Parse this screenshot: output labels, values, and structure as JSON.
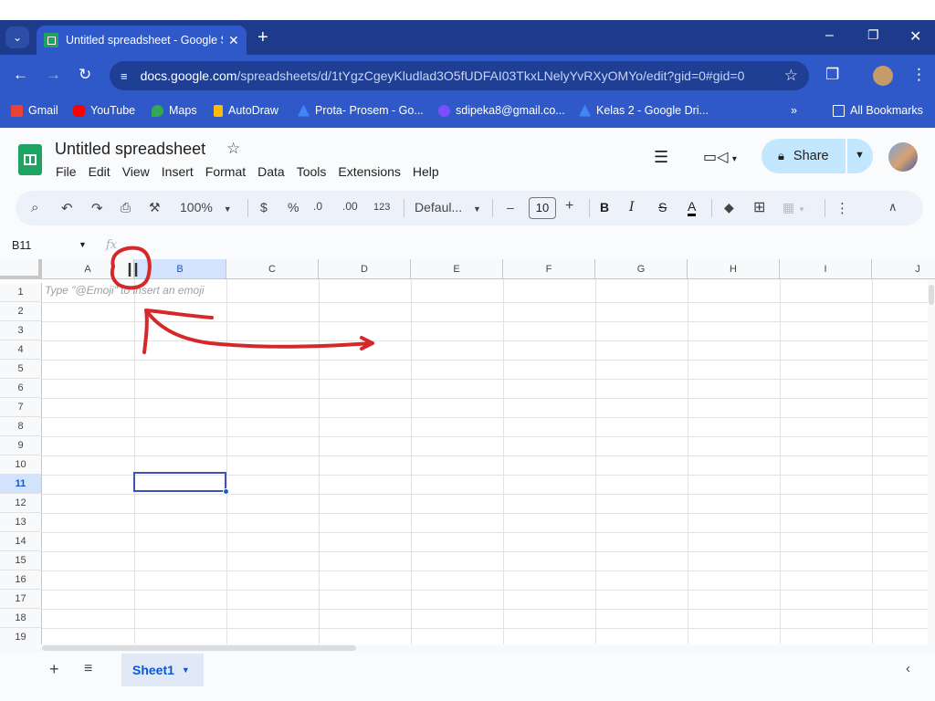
{
  "browser": {
    "tab_title": "Untitled spreadsheet - Google S",
    "new_tab_label": "+",
    "url_host": "docs.google.com",
    "url_path": "/spreadsheets/d/1tYgzCgeyKludlad3O5fUDFAI03TkxLNelyYvRXyOMYo/edit?gid=0#gid=0",
    "bookmarks": [
      "Gmail",
      "YouTube",
      "Maps",
      "AutoDraw",
      "Prota- Prosem - Go...",
      "sdipeka8@gmail.co...",
      "Kelas 2 - Google Dri..."
    ],
    "overflow_label": "»",
    "all_bookmarks_label": "All Bookmarks"
  },
  "sheets": {
    "doc_title": "Untitled spreadsheet",
    "menus": [
      "File",
      "Edit",
      "View",
      "Insert",
      "Format",
      "Data",
      "Tools",
      "Extensions",
      "Help"
    ],
    "share_label": "Share",
    "toolbar": {
      "zoom": "100%",
      "currency": "$",
      "percent": "%",
      "decrease_decimal": ".0",
      "increase_decimal": ".00",
      "number_format": "123",
      "font": "Defaul...",
      "font_size": "10",
      "bold": "B",
      "italic": "I",
      "strike": "S",
      "text_color": "A"
    },
    "name_box": "B11",
    "fx": "fx",
    "columns": [
      "A",
      "B",
      "C",
      "D",
      "E",
      "F",
      "G",
      "H",
      "I",
      "J"
    ],
    "rows": [
      "1",
      "2",
      "3",
      "4",
      "5",
      "6",
      "7",
      "8",
      "9",
      "10",
      "11",
      "12",
      "13",
      "14",
      "15",
      "16",
      "17",
      "18",
      "19"
    ],
    "cell_a1": "Type \"@Emoji\" to insert an emoji",
    "sheet_tab": "Sheet1"
  },
  "colors": {
    "tab_bar": "#1e3a8a",
    "chrome": "#2f59c9",
    "share_button": "#c2e7ff",
    "selection": "#3f51b5",
    "annotation": "#d62828"
  }
}
